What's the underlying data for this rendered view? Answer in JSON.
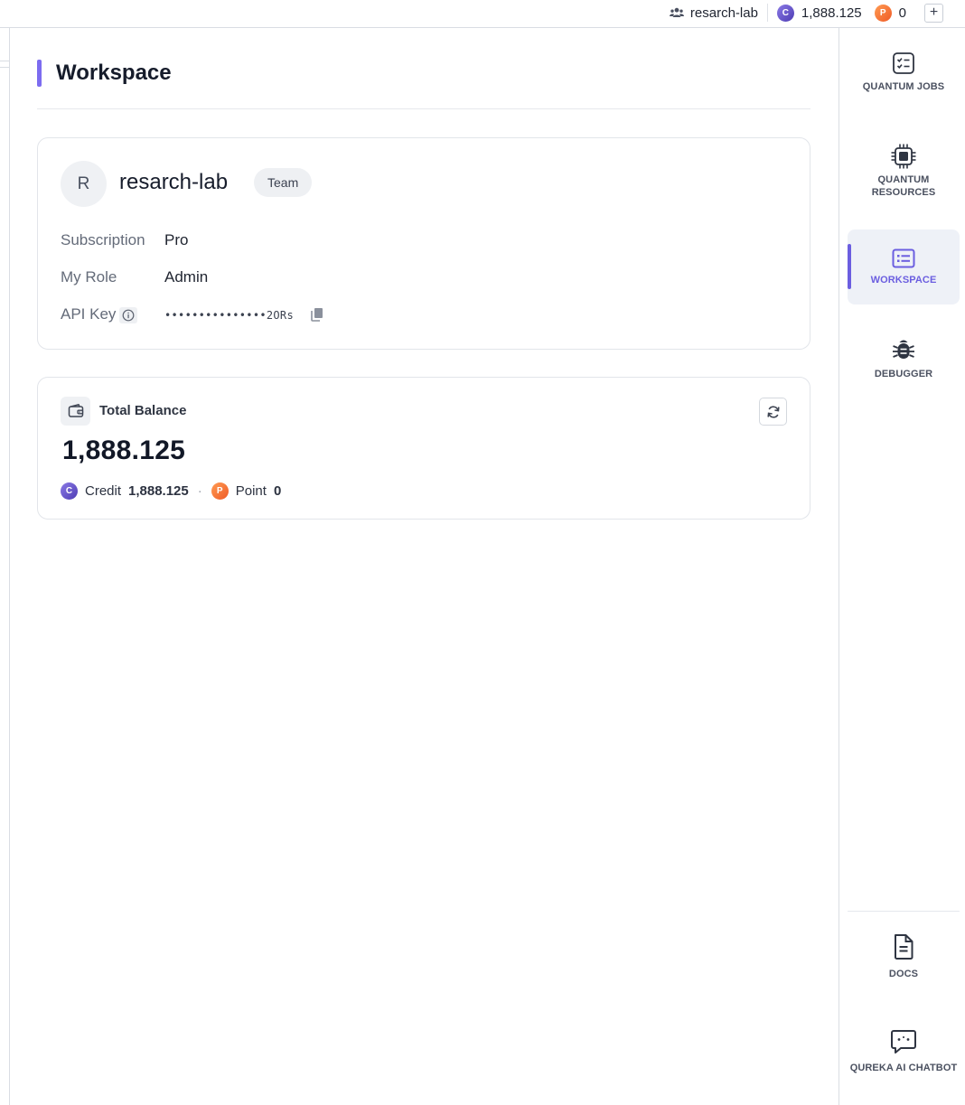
{
  "topbar": {
    "team_name": "resarch-lab",
    "credit_coin": "C",
    "credit_amount": "1,888.125",
    "point_coin": "P",
    "point_amount": "0",
    "add_label": "+"
  },
  "sidebar": {
    "items": [
      {
        "label": "QUANTUM JOBS",
        "icon": "checklist-icon"
      },
      {
        "label": "QUANTUM RESOURCES",
        "icon": "chip-icon"
      },
      {
        "label": "WORKSPACE",
        "icon": "workspace-icon",
        "active": true
      },
      {
        "label": "DEBUGGER",
        "icon": "bug-icon"
      },
      {
        "label": "DOCS",
        "icon": "document-icon"
      },
      {
        "label": "QUREKA AI CHATBOT",
        "icon": "chat-icon"
      }
    ]
  },
  "main": {
    "title": "Workspace",
    "workspace": {
      "avatar_letter": "R",
      "name": "resarch-lab",
      "badge": "Team",
      "subscription_label": "Subscription",
      "subscription_value": "Pro",
      "role_label": "My Role",
      "role_value": "Admin",
      "api_key_label": "API Key",
      "api_key_value": "•••••••••••••••2ORs"
    },
    "balance": {
      "label": "Total Balance",
      "total": "1,888.125",
      "credit_label": "Credit",
      "credit_value": "1,888.125",
      "separator": "·",
      "point_label": "Point",
      "point_value": "0"
    }
  },
  "colors": {
    "accent": "#6b5ee0",
    "credit_coin": "#5b48c8",
    "point_coin": "#f06a2d"
  }
}
